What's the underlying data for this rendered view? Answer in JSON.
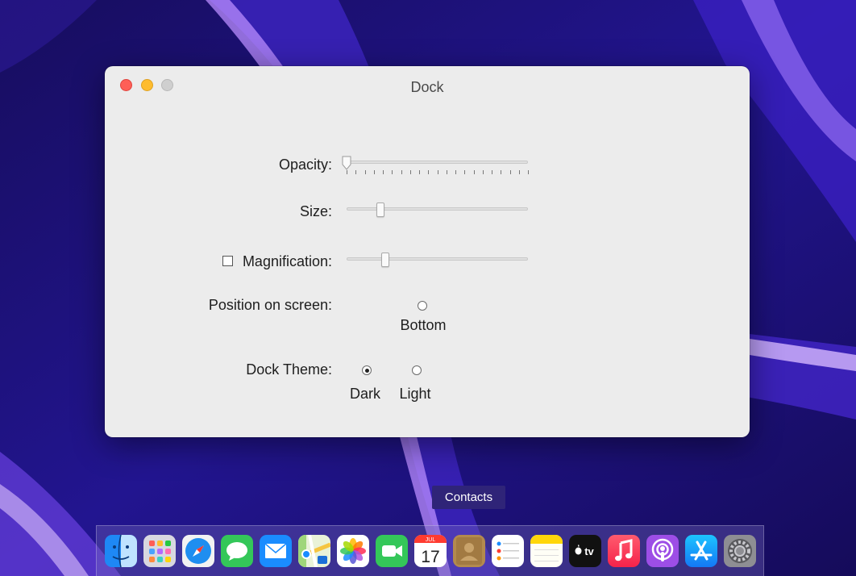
{
  "window": {
    "title": "Dock"
  },
  "settings": {
    "opacity": {
      "label": "Opacity:",
      "value": 0.0
    },
    "size": {
      "label": "Size:",
      "value": 0.17
    },
    "magnification": {
      "label": "Magnification:",
      "checked": false,
      "value": 0.2
    },
    "position": {
      "label": "Position on screen:",
      "options": [
        "Bottom"
      ],
      "selected": ""
    },
    "theme": {
      "label": "Dock Theme:",
      "options": [
        "Dark",
        "Light"
      ],
      "selected": "Dark"
    }
  },
  "tooltip": {
    "text": "Contacts"
  },
  "dock": {
    "calendar_month": "JUL",
    "calendar_day": "17",
    "tv_text": "tv",
    "items": [
      "Finder",
      "Launchpad",
      "Safari",
      "Messages",
      "Mail",
      "Maps",
      "Photos",
      "FaceTime",
      "Calendar",
      "Contacts",
      "Reminders",
      "Notes",
      "TV",
      "Music",
      "Podcasts",
      "App Store",
      "System Preferences"
    ]
  },
  "colors": {
    "close": "#fe5f57",
    "minimize": "#febc2e",
    "zoom": "#cfcfcf",
    "window_bg": "#ececec"
  }
}
